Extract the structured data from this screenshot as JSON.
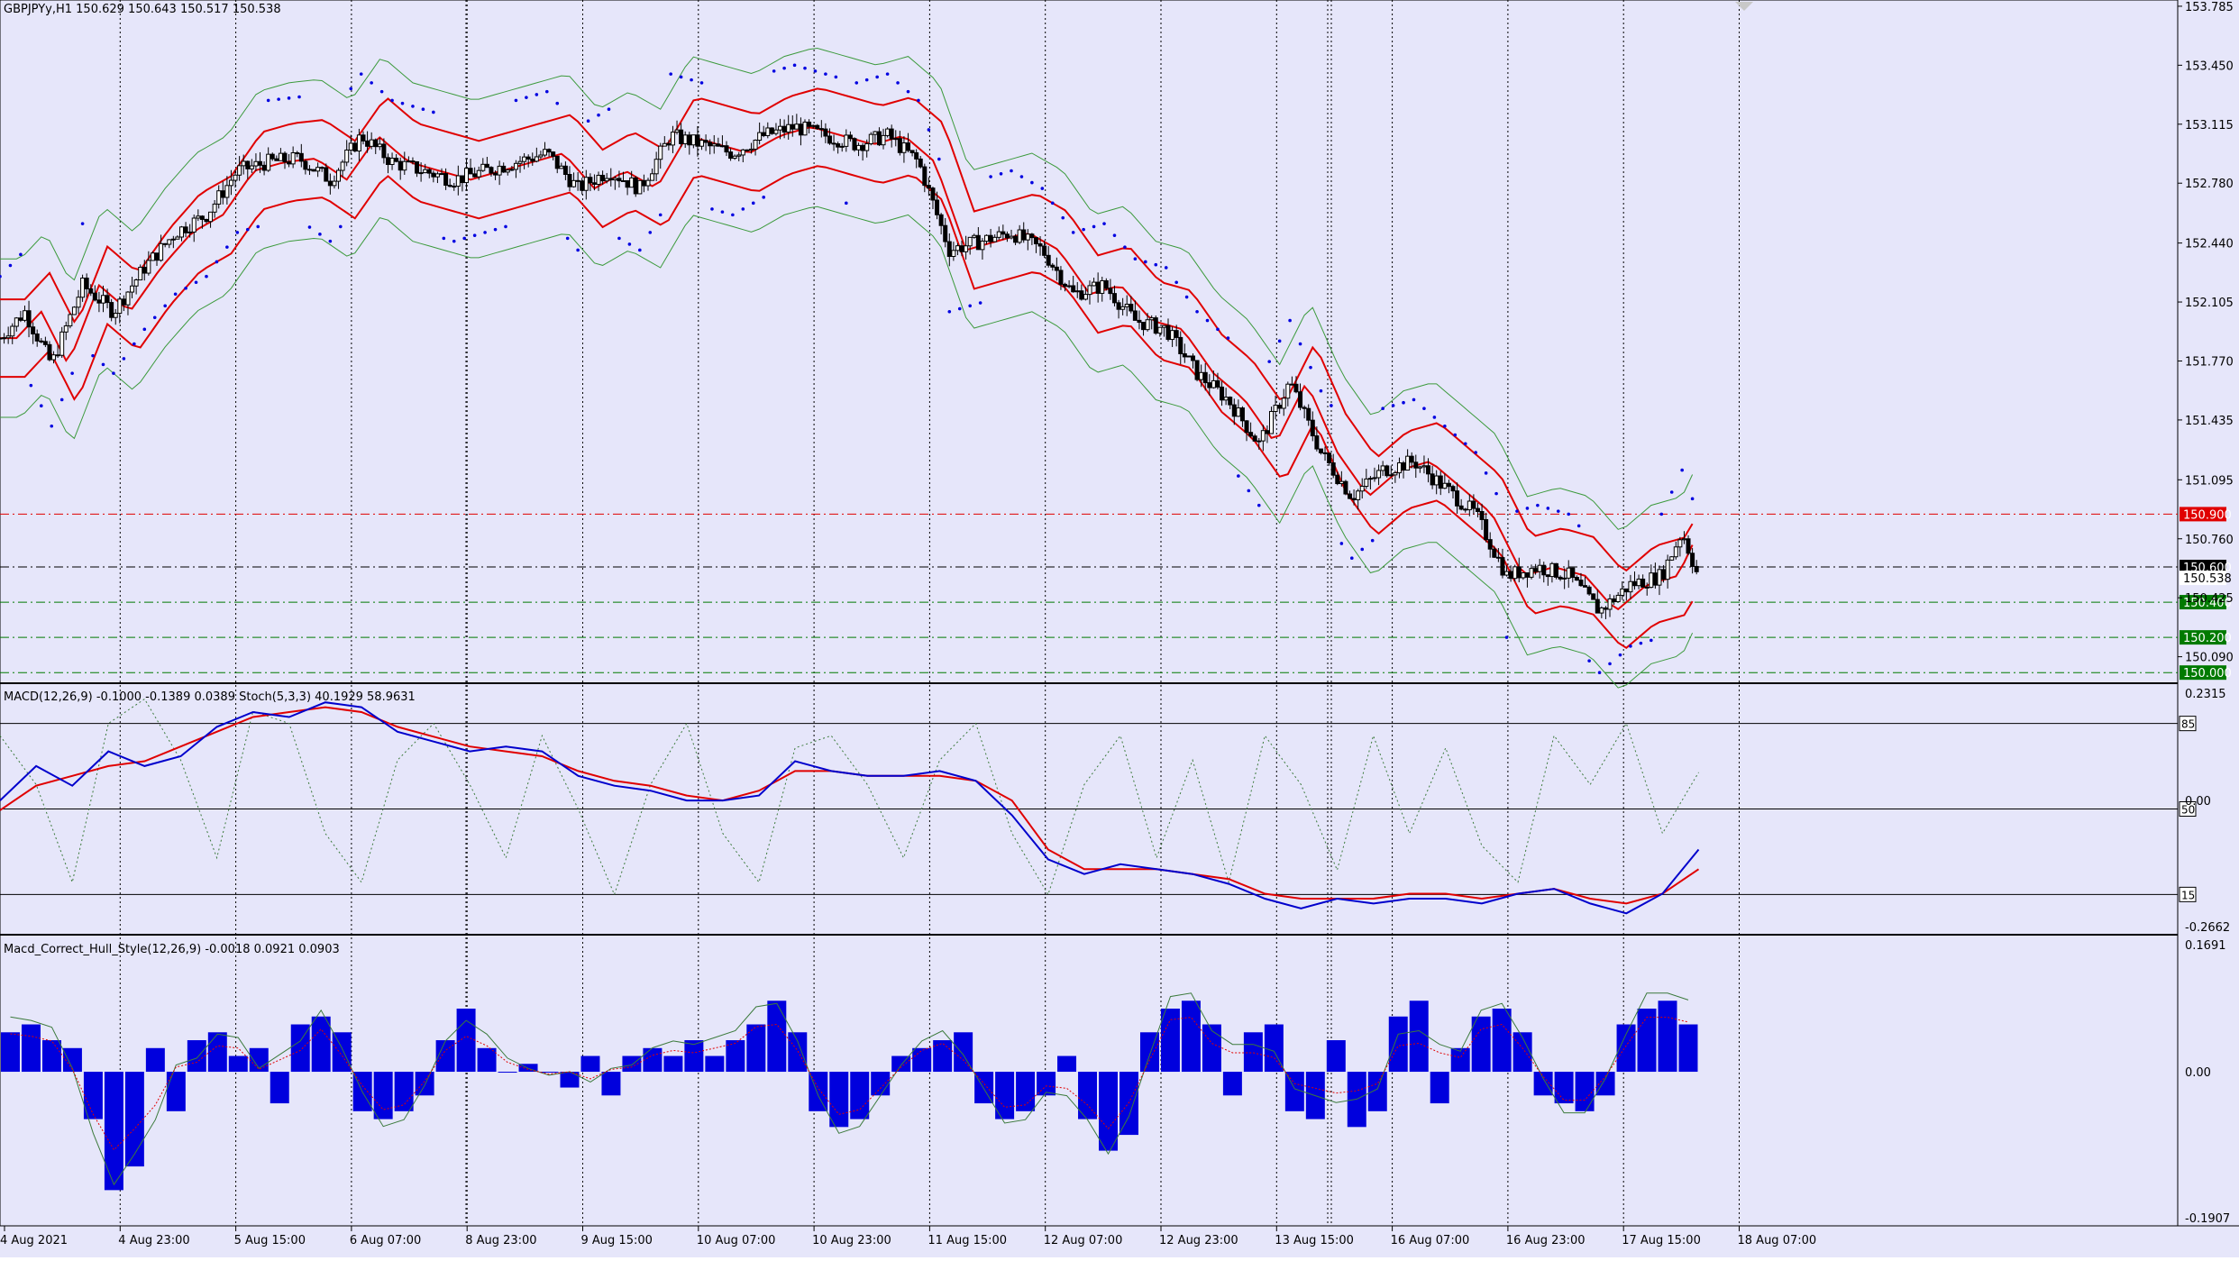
{
  "main_header": "GBPJPYy,H1  150.629 150.643 150.517 150.538",
  "macd_header": "MACD(12,26,9) -0.1000 -0.1389 0.0389  Stoch(5,3,3) 40.1929 58.9631",
  "hull_header": "Macd_Correct_Hull_Style(12,26,9) -0.0018 0.0921 0.0903",
  "colors": {
    "background": "#e6e6fa",
    "bull_candle": "#ffffff",
    "bear_candle": "#000000",
    "bollinger_outer": "#3c9a3c",
    "envelope_red": "#e00000",
    "sar": "#0000e0",
    "macd_line": "#0000cc",
    "signal_line": "#e00000",
    "stoch": "#3c7a3c",
    "histogram": "#0000dd"
  },
  "chart_data": [
    {
      "type": "candlestick",
      "title": "GBPJPYy,H1  150.629 150.643 150.517 150.538",
      "x_labels": [
        "4 Aug 2021",
        "4 Aug 23:00",
        "5 Aug 15:00",
        "6 Aug 07:00",
        "8 Aug 23:00",
        "9 Aug 15:00",
        "10 Aug 07:00",
        "10 Aug 23:00",
        "11 Aug 15:00",
        "12 Aug 07:00",
        "12 Aug 23:00",
        "13 Aug 15:00",
        "16 Aug 07:00",
        "16 Aug 23:00",
        "17 Aug 15:00",
        "18 Aug 07:00"
      ],
      "y_ticks": [
        "153.785",
        "153.450",
        "153.115",
        "152.780",
        "152.440",
        "152.105",
        "151.770",
        "151.435",
        "151.095",
        "150.760",
        "150.425",
        "150.090"
      ],
      "ylim": [
        149.96,
        153.8
      ],
      "price_levels": [
        {
          "label": "150.900",
          "value": 150.9,
          "color": "#e00000",
          "style": "dash-dot"
        },
        {
          "label": "150.600",
          "value": 150.6,
          "color": "#000000",
          "style": "dash-dot"
        },
        {
          "label": "150.538",
          "value": 150.538,
          "color": "#000000",
          "style": "none"
        },
        {
          "label": "150.400",
          "value": 150.4,
          "color": "#007a00",
          "style": "dash-dot"
        },
        {
          "label": "150.200",
          "value": 150.2,
          "color": "#007a00",
          "style": "dash-dot"
        },
        {
          "label": "150.000",
          "value": 150.0,
          "color": "#007a00",
          "style": "dash-dot"
        }
      ],
      "price_path": [
        [
          0,
          151.9
        ],
        [
          12,
          152.05
        ],
        [
          25,
          151.75
        ],
        [
          40,
          152.2
        ],
        [
          55,
          152.05
        ],
        [
          70,
          152.3
        ],
        [
          85,
          152.5
        ],
        [
          100,
          152.6
        ],
        [
          115,
          152.85
        ],
        [
          130,
          152.9
        ],
        [
          145,
          152.92
        ],
        [
          160,
          152.8
        ],
        [
          175,
          153.05
        ],
        [
          190,
          152.9
        ],
        [
          205,
          152.85
        ],
        [
          220,
          152.8
        ],
        [
          235,
          152.85
        ],
        [
          250,
          152.9
        ],
        [
          265,
          152.95
        ],
        [
          280,
          152.75
        ],
        [
          295,
          152.85
        ],
        [
          310,
          152.75
        ],
        [
          325,
          153.05
        ],
        [
          340,
          153.0
        ],
        [
          355,
          152.95
        ],
        [
          370,
          153.05
        ],
        [
          385,
          153.1
        ],
        [
          400,
          153.05
        ],
        [
          415,
          153.0
        ],
        [
          430,
          153.05
        ],
        [
          445,
          152.9
        ],
        [
          460,
          152.4
        ],
        [
          475,
          152.45
        ],
        [
          490,
          152.5
        ],
        [
          505,
          152.4
        ],
        [
          520,
          152.15
        ],
        [
          535,
          152.2
        ],
        [
          550,
          152.0
        ],
        [
          565,
          151.95
        ],
        [
          580,
          151.7
        ],
        [
          595,
          151.55
        ],
        [
          610,
          151.3
        ],
        [
          625,
          151.65
        ],
        [
          640,
          151.25
        ],
        [
          655,
          151.0
        ],
        [
          670,
          151.15
        ],
        [
          685,
          151.2
        ],
        [
          700,
          151.05
        ],
        [
          715,
          150.9
        ],
        [
          730,
          150.55
        ],
        [
          745,
          150.6
        ],
        [
          760,
          150.55
        ],
        [
          775,
          150.35
        ],
        [
          790,
          150.5
        ],
        [
          805,
          150.55
        ],
        [
          815,
          150.8
        ],
        [
          823,
          150.54
        ]
      ],
      "lines": [
        "Bollinger Bands (outer)",
        "Envelope / Bollinger (red)",
        "Parabolic SAR (dotted)"
      ]
    },
    {
      "type": "line",
      "title": "MACD(12,26,9) -0.1000 -0.1389 0.0389  Stoch(5,3,3) 40.1929 58.9631",
      "y_ticks": [
        "0.2315",
        "0.00",
        "-0.2662"
      ],
      "level_labels": [
        "85",
        "50",
        "15"
      ],
      "ylim": [
        -0.2662,
        0.2315
      ],
      "series": [
        {
          "values": [
            0.0,
            0.07,
            0.03,
            0.1,
            0.07,
            0.09,
            0.15,
            0.18,
            0.17,
            0.2,
            0.19,
            0.14,
            0.12,
            0.1,
            0.11,
            0.1,
            0.05,
            0.03,
            0.02,
            0.0,
            0.0,
            0.01,
            0.08,
            0.06,
            0.05,
            0.05,
            0.06,
            0.04,
            -0.03,
            -0.12,
            -0.15,
            -0.13,
            -0.14,
            -0.15,
            -0.17,
            -0.2,
            -0.22,
            -0.2,
            -0.21,
            -0.2,
            -0.2,
            -0.21,
            -0.19,
            -0.18,
            -0.21,
            -0.23,
            -0.19,
            -0.1
          ]
        },
        {
          "values": [
            -0.02,
            0.03,
            0.05,
            0.07,
            0.08,
            0.11,
            0.14,
            0.17,
            0.18,
            0.19,
            0.18,
            0.15,
            0.13,
            0.11,
            0.1,
            0.09,
            0.06,
            0.04,
            0.03,
            0.01,
            0.0,
            0.02,
            0.06,
            0.06,
            0.05,
            0.05,
            0.05,
            0.04,
            0.0,
            -0.1,
            -0.14,
            -0.14,
            -0.14,
            -0.15,
            -0.16,
            -0.19,
            -0.2,
            -0.2,
            -0.2,
            -0.19,
            -0.19,
            -0.2,
            -0.19,
            -0.18,
            -0.2,
            -0.21,
            -0.19,
            -0.14
          ]
        },
        {
          "values": [
            80,
            60,
            20,
            85,
            95,
            70,
            30,
            90,
            85,
            40,
            20,
            70,
            85,
            60,
            30,
            80,
            50,
            15,
            60,
            85,
            40,
            20,
            75,
            80,
            60,
            30,
            70,
            85,
            40,
            15,
            60,
            80,
            30,
            70,
            20,
            80,
            60,
            25,
            80,
            40,
            75,
            35,
            20,
            80,
            60,
            85,
            40,
            65
          ]
        }
      ]
    },
    {
      "type": "bar",
      "title": "Macd_Correct_Hull_Style(12,26,9) -0.0018 0.0921 0.0903",
      "y_ticks": [
        "0.1691",
        "0.00",
        "-0.1907"
      ],
      "ylim": [
        -0.1907,
        0.1691
      ],
      "values": [
        0.05,
        0.06,
        0.04,
        0.03,
        -0.06,
        -0.15,
        -0.12,
        0.03,
        -0.05,
        0.04,
        0.05,
        0.02,
        0.03,
        -0.04,
        0.06,
        0.07,
        0.05,
        -0.05,
        -0.06,
        -0.05,
        -0.03,
        0.04,
        0.08,
        0.03,
        0.0,
        0.01,
        0.0,
        -0.02,
        0.02,
        -0.03,
        0.02,
        0.03,
        0.02,
        0.04,
        0.02,
        0.04,
        0.06,
        0.09,
        0.05,
        -0.05,
        -0.07,
        -0.06,
        -0.03,
        0.02,
        0.03,
        0.04,
        0.05,
        -0.04,
        -0.06,
        -0.05,
        -0.03,
        0.02,
        -0.06,
        -0.1,
        -0.08,
        0.05,
        0.08,
        0.09,
        0.06,
        -0.03,
        0.05,
        0.06,
        -0.05,
        -0.06,
        0.04,
        -0.07,
        -0.05,
        0.07,
        0.09,
        -0.04,
        0.03,
        0.07,
        0.08,
        0.05,
        -0.03,
        -0.04,
        -0.05,
        -0.03,
        0.06,
        0.08,
        0.09,
        0.06
      ]
    }
  ]
}
